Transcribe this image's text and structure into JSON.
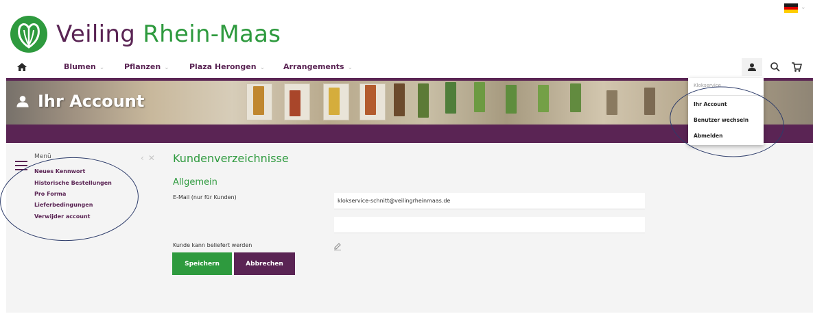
{
  "header": {
    "language": "de",
    "brand": {
      "name_part1": "Veiling",
      "name_part2": "Rhein-Maas"
    }
  },
  "colors": {
    "brand_purple": "#5a2454",
    "brand_green": "#2e9a3e"
  },
  "nav": {
    "home_icon": "home-icon",
    "items": [
      {
        "label": "Blumen",
        "has_dropdown": true
      },
      {
        "label": "Pflanzen",
        "has_dropdown": true
      },
      {
        "label": "Plaza Herongen",
        "has_dropdown": true
      },
      {
        "label": "Arrangements",
        "has_dropdown": true
      }
    ],
    "icons": [
      "user-icon",
      "search-icon",
      "cart-icon"
    ]
  },
  "banner": {
    "title": "Ihr Account",
    "icon": "user-icon"
  },
  "account_dropdown": {
    "user_name": "Klokservice",
    "items": [
      {
        "label": "Ihr Account"
      },
      {
        "label": "Benutzer wechseln"
      },
      {
        "label": "Abmelden"
      }
    ]
  },
  "sidebar": {
    "title": "Menü",
    "links": [
      {
        "label": "Neues Kennwort"
      },
      {
        "label": "Historische Bestellungen"
      },
      {
        "label": "Pro Forma"
      },
      {
        "label": "Lieferbedingungen"
      },
      {
        "label": "Verwijder account"
      }
    ]
  },
  "main": {
    "heading": "Kundenverzeichnisse",
    "section_heading": "Allgemein",
    "email_label": "E-Mail (nur für Kunden)",
    "email_value": "klokservice-schnitt@veilingrheinmaas.de",
    "second_field_value": "",
    "deliverable_label": "Kunde kann beliefert werden",
    "save_label": "Speichern",
    "cancel_label": "Abbrechen"
  }
}
